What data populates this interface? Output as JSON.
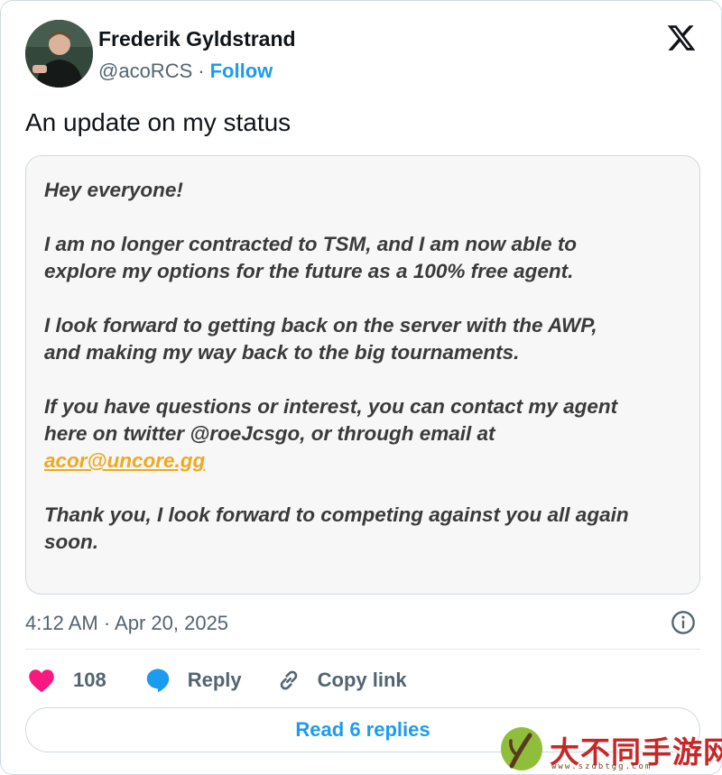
{
  "author": {
    "name": "Frederik Gyldstrand",
    "handle": "@acoRCS",
    "separator": "·",
    "follow_label": "Follow"
  },
  "tweet": {
    "text": "An update on my status",
    "image_text": {
      "greeting": "Hey everyone!",
      "para1": "I am no longer contracted to TSM, and I am now able to\nexplore my options for the future as a 100% free agent.",
      "para2": "I look forward to getting back on the server with the AWP,\nand making my way back to the big tournaments.",
      "para3": "If you have questions or interest, you can contact my agent\nhere on twitter @roeJcsgo, or through email at",
      "email": "acor@uncore.gg",
      "para4": "Thank you, I look forward to competing against you all again\nsoon."
    },
    "timestamp": "4:12 AM · Apr 20, 2025"
  },
  "actions": {
    "like_count": "108",
    "reply_label": "Reply",
    "copy_link_label": "Copy link"
  },
  "read_replies_label": "Read 6 replies",
  "watermark": {
    "text": "大不同手游网",
    "url": "www.szdbtgg.com"
  },
  "colors": {
    "accent": "#1d9bf0",
    "like": "#f91880",
    "email": "#f0a81f",
    "watermark": "#c62828"
  },
  "icons": [
    "x-logo-icon",
    "info-icon",
    "heart-icon",
    "reply-bubble-icon",
    "link-icon",
    "leaf-logo-icon"
  ]
}
